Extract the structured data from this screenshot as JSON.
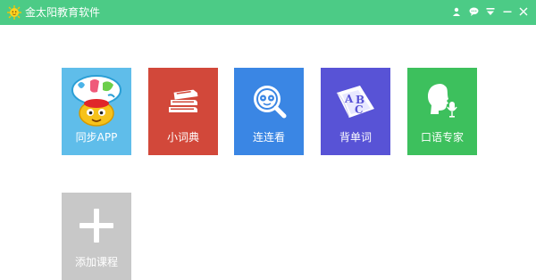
{
  "window": {
    "title": "金太阳教育软件",
    "accent_color": "#4ccb86",
    "controls": [
      "user-icon",
      "chat-icon",
      "dropdown-icon",
      "minimize-icon",
      "close-icon"
    ]
  },
  "tiles": [
    {
      "label": "同步APP",
      "icon": "cartoon-sun-app-icon",
      "color": "#5fbdea"
    },
    {
      "label": "小词典",
      "icon": "books-icon",
      "color": "#d2483a"
    },
    {
      "label": "连连看",
      "icon": "magnifier-face-icon",
      "color": "#3a86e4"
    },
    {
      "label": "背单词",
      "icon": "abc-letters-icon",
      "color": "#5853d6"
    },
    {
      "label": "口语专家",
      "icon": "speaking-head-icon",
      "color": "#3dc05d"
    }
  ],
  "add_tile": {
    "label": "添加课程",
    "icon": "plus-icon",
    "color": "#c8c8c8"
  }
}
